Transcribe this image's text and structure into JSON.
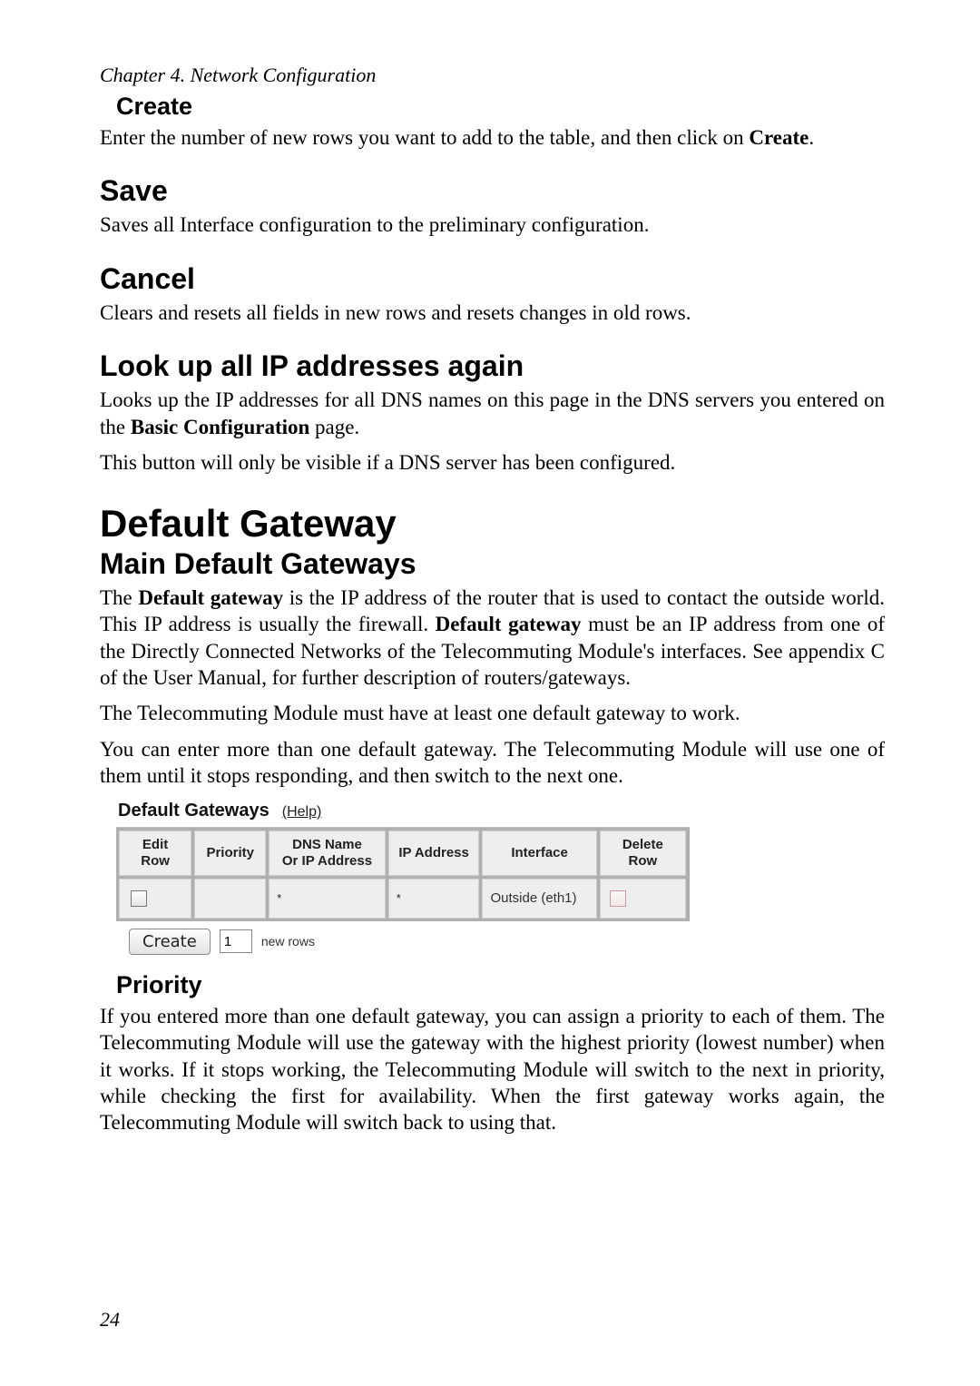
{
  "chapter": "Chapter 4. Network Configuration",
  "sections": {
    "create": {
      "title": "Create",
      "text_before": "Enter the number of new rows you want to add to the table, and then click on ",
      "bold": "Create",
      "after": "."
    },
    "save": {
      "title": "Save",
      "text": "Saves all Interface configuration to the preliminary configuration."
    },
    "cancel": {
      "title": "Cancel",
      "text": "Clears and resets all fields in new rows and resets changes in old rows."
    },
    "lookup": {
      "title": "Look up all IP addresses again",
      "p1_a": "Looks up the IP addresses for all DNS names on this page in the DNS servers you entered on the ",
      "p1_bold": "Basic Configuration",
      "p1_b": " page.",
      "p2": "This button will only be visible if a DNS server has been configured."
    },
    "default_gateway": {
      "title": "Default Gateway",
      "main_title": "Main Default Gateways",
      "p1_a": "The ",
      "p1_bold1": "Default gateway",
      "p1_b": " is the IP address of the router that is used to contact the outside world. This IP address is usually the firewall. ",
      "p1_bold2": "Default gateway",
      "p1_c": " must be an IP address from one of the Directly Connected Networks of the Telecommuting Module's interfaces. See appendix C of the User Manual, for further description of routers/gateways.",
      "p2": "The Telecommuting Module must have at least one default gateway to work.",
      "p3": "You can enter more than one default gateway. The Telecommuting Module will use one of them until it stops responding, and then switch to the next one."
    },
    "priority": {
      "title": "Priority",
      "text": "If you entered more than one default gateway, you can assign a priority to each of them. The Telecommuting Module will use the gateway with the highest priority (lowest number) when it works. If it stops working, the Telecommuting Module will switch to the next in priority, while checking the first for availability. When the first gateway works again, the Telecommuting Module will switch back to using that."
    }
  },
  "widget": {
    "heading": "Default Gateways",
    "help": "(Help)",
    "headers": {
      "edit": "Edit Row",
      "priority": "Priority",
      "dns1": "DNS Name",
      "dns2": "Or IP Address",
      "ip": "IP Address",
      "interface": "Interface",
      "delete": "Delete Row"
    },
    "row": {
      "star1": "*",
      "star2": "*",
      "interface": "Outside (eth1)"
    },
    "create_btn": "Create",
    "num": "1",
    "new_rows": "new rows"
  },
  "page_number": "24"
}
